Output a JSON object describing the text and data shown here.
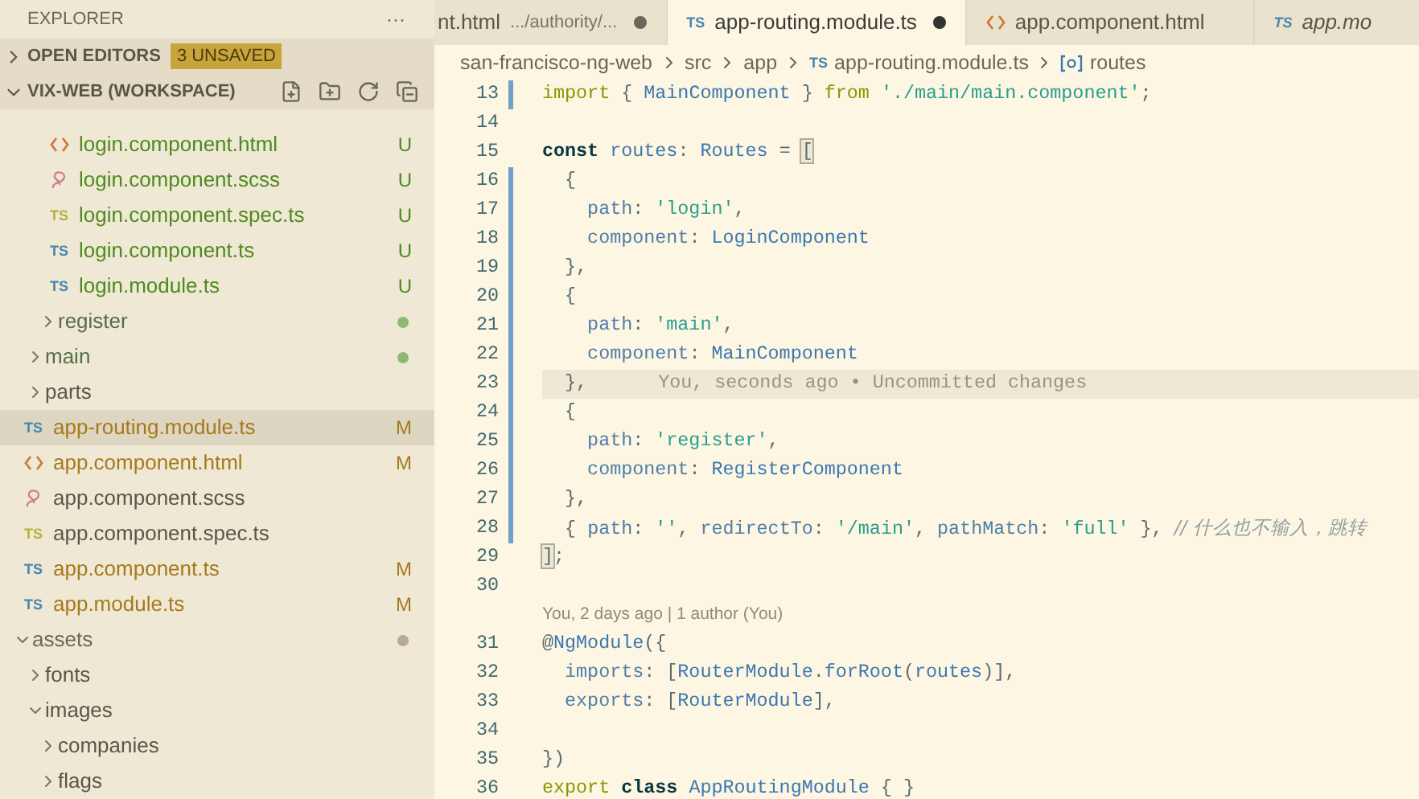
{
  "sidebar": {
    "title": "EXPLORER",
    "more": "···",
    "sections": [
      {
        "label": "OPEN EDITORS",
        "expanded": false,
        "badge": "3 UNSAVED"
      },
      {
        "label": "VIX-WEB (WORKSPACE)",
        "expanded": true
      }
    ],
    "tree": [
      {
        "kind": "folder",
        "children": [
          {
            "kind": "folder",
            "children": [
              {
                "kind": "folder",
                "children": [
                  {
                    "name": "login.component.html",
                    "kind": "html",
                    "status": "U",
                    "selected": false
                  },
                  {
                    "name": "login.component.scss",
                    "kind": "scss",
                    "status": "U",
                    "selected": false
                  },
                  {
                    "name": "login.component.spec.ts",
                    "kind": "spec",
                    "icon_label": "TS",
                    "status": "U",
                    "selected": false
                  },
                  {
                    "name": "login.component.ts",
                    "kind": "ts",
                    "icon_label": "TS",
                    "status": "U",
                    "selected": false
                  },
                  {
                    "name": "login.module.ts",
                    "kind": "ts",
                    "icon_label": "TS",
                    "status": "U",
                    "selected": false
                  }
                ]
              },
              {
                "name": "register",
                "kind": "folder",
                "expanded": false,
                "color": "#8fb873",
                "selected": false
              }
            ]
          },
          {
            "name": "main",
            "kind": "folder",
            "expanded": false,
            "color": "#8fb873",
            "selected": false
          },
          {
            "name": "parts",
            "kind": "folder",
            "expanded": false,
            "selected": false
          },
          {
            "name": "app-routing.module.ts",
            "kind": "ts",
            "icon_label": "TS",
            "status": "M",
            "selected": true
          },
          {
            "name": "app.component.html",
            "kind": "html",
            "status": "M",
            "selected": false
          },
          {
            "name": "app.component.scss",
            "kind": "scss",
            "selected": false
          },
          {
            "name": "app.component.spec.ts",
            "kind": "spec",
            "icon_label": "TS",
            "selected": false
          },
          {
            "name": "app.component.ts",
            "kind": "ts",
            "icon_label": "TS",
            "status": "M",
            "selected": false
          },
          {
            "name": "app.module.ts",
            "kind": "ts",
            "icon_label": "TS",
            "status": "M",
            "selected": false
          }
        ]
      },
      {
        "name": "assets",
        "kind": "folder",
        "expanded": true,
        "color": "#b8aa92",
        "selected": false,
        "children": [
          {
            "name": "fonts",
            "kind": "folder",
            "expanded": false,
            "selected": false
          },
          {
            "name": "images",
            "kind": "folder",
            "expanded": true,
            "selected": false,
            "children": [
              {
                "name": "companies",
                "kind": "folder",
                "expanded": false,
                "selected": false
              },
              {
                "name": "flags",
                "kind": "folder",
                "expanded": false,
                "selected": false
              }
            ]
          }
        ]
      }
    ]
  },
  "tabs": [
    {
      "label": "nt.html",
      "description": ".../authority/...",
      "selected": false,
      "dirty": true,
      "preview": false
    },
    {
      "label": "app-routing.module.ts",
      "kind": "ts",
      "icon_label": "TS",
      "selected": true,
      "dirty": true,
      "preview": false
    },
    {
      "label": "app.component.html",
      "kind": "html",
      "selected": false,
      "dirty": false,
      "preview": false
    },
    {
      "label": "app.mo",
      "kind": "ts",
      "icon_label": "TS",
      "selected": false,
      "dirty": false,
      "preview": true
    }
  ],
  "breadcrumb": [
    {
      "label": "san-francisco-ng-web"
    },
    {
      "label": "src"
    },
    {
      "label": "app"
    },
    {
      "label": "app-routing.module.ts",
      "kind": "ts",
      "icon_label": "TS"
    },
    {
      "label": "routes",
      "kind": "symbol"
    }
  ],
  "code": [
    {
      "number": "13",
      "modified": true,
      "current": false,
      "tokens": [
        {
          "kind": "kw",
          "text": "import "
        },
        {
          "kind": "p",
          "text": "{ "
        },
        {
          "kind": "id",
          "text": "MainComponent"
        },
        {
          "kind": "p",
          "text": " } "
        },
        {
          "kind": "kw",
          "text": "from "
        },
        {
          "kind": "str",
          "text": "'./main/main.component'"
        },
        {
          "kind": "p",
          "text": ";"
        }
      ]
    },
    {
      "number": "14",
      "modified": false,
      "current": false
    },
    {
      "number": "15",
      "modified": false,
      "current": false,
      "tokens": [
        {
          "kind": "bold",
          "text": "const "
        },
        {
          "kind": "id",
          "text": "routes"
        },
        {
          "kind": "p",
          "text": ": "
        },
        {
          "kind": "id",
          "text": "Routes"
        },
        {
          "kind": "p",
          "text": " = "
        },
        {
          "kind": "match",
          "text": "["
        }
      ]
    },
    {
      "number": "16",
      "modified": true,
      "current": false,
      "tokens": [
        {
          "kind": "p",
          "text": "  {"
        }
      ]
    },
    {
      "number": "17",
      "modified": true,
      "current": false,
      "tokens": [
        {
          "kind": "prop",
          "text": "    path"
        },
        {
          "kind": "p",
          "text": ": "
        },
        {
          "kind": "str",
          "text": "'login'"
        },
        {
          "kind": "p",
          "text": ","
        }
      ]
    },
    {
      "number": "18",
      "modified": true,
      "current": false,
      "tokens": [
        {
          "kind": "prop",
          "text": "    component"
        },
        {
          "kind": "p",
          "text": ": "
        },
        {
          "kind": "id",
          "text": "LoginComponent"
        }
      ]
    },
    {
      "number": "19",
      "modified": true,
      "current": false,
      "tokens": [
        {
          "kind": "p",
          "text": "  },"
        }
      ]
    },
    {
      "number": "20",
      "modified": true,
      "current": false,
      "tokens": [
        {
          "kind": "p",
          "text": "  {"
        }
      ]
    },
    {
      "number": "21",
      "modified": true,
      "current": false,
      "tokens": [
        {
          "kind": "prop",
          "text": "    path"
        },
        {
          "kind": "p",
          "text": ": "
        },
        {
          "kind": "str",
          "text": "'main'"
        },
        {
          "kind": "p",
          "text": ","
        }
      ]
    },
    {
      "number": "22",
      "modified": true,
      "current": false,
      "tokens": [
        {
          "kind": "prop",
          "text": "    component"
        },
        {
          "kind": "p",
          "text": ": "
        },
        {
          "kind": "id",
          "text": "MainComponent"
        }
      ]
    },
    {
      "number": "23",
      "modified": true,
      "current": true,
      "blame": "You, seconds ago • Uncommitted changes",
      "tokens": [
        {
          "kind": "p",
          "text": "  },"
        }
      ]
    },
    {
      "number": "24",
      "modified": true,
      "current": false,
      "tokens": [
        {
          "kind": "p",
          "text": "  {"
        }
      ]
    },
    {
      "number": "25",
      "modified": true,
      "current": false,
      "tokens": [
        {
          "kind": "prop",
          "text": "    path"
        },
        {
          "kind": "p",
          "text": ": "
        },
        {
          "kind": "str",
          "text": "'register'"
        },
        {
          "kind": "p",
          "text": ","
        }
      ]
    },
    {
      "number": "26",
      "modified": true,
      "current": false,
      "tokens": [
        {
          "kind": "prop",
          "text": "    component"
        },
        {
          "kind": "p",
          "text": ": "
        },
        {
          "kind": "id",
          "text": "RegisterComponent"
        }
      ]
    },
    {
      "number": "27",
      "modified": true,
      "current": false,
      "tokens": [
        {
          "kind": "p",
          "text": "  },"
        }
      ]
    },
    {
      "number": "28",
      "modified": true,
      "current": false,
      "tokens": [
        {
          "kind": "p",
          "text": "  { "
        },
        {
          "kind": "prop",
          "text": "path"
        },
        {
          "kind": "p",
          "text": ": "
        },
        {
          "kind": "str",
          "text": "''"
        },
        {
          "kind": "p",
          "text": ", "
        },
        {
          "kind": "prop",
          "text": "redirectTo"
        },
        {
          "kind": "p",
          "text": ": "
        },
        {
          "kind": "str",
          "text": "'/main'"
        },
        {
          "kind": "p",
          "text": ", "
        },
        {
          "kind": "prop",
          "text": "pathMatch"
        },
        {
          "kind": "p",
          "text": ": "
        },
        {
          "kind": "str",
          "text": "'full'"
        },
        {
          "kind": "p",
          "text": " }, "
        },
        {
          "kind": "cm",
          "text": "// 什么也不输入，跳转"
        }
      ]
    },
    {
      "number": "29",
      "modified": false,
      "current": false,
      "tokens": [
        {
          "kind": "match",
          "text": "]"
        },
        {
          "kind": "p",
          "text": ";"
        }
      ]
    },
    {
      "number": "30",
      "modified": false,
      "current": false
    },
    {
      "codelens": "You, 2 days ago | 1 author (You)"
    },
    {
      "number": "31",
      "modified": false,
      "current": false,
      "tokens": [
        {
          "kind": "p",
          "text": "@"
        },
        {
          "kind": "id",
          "text": "NgModule"
        },
        {
          "kind": "p",
          "text": "({"
        }
      ]
    },
    {
      "number": "32",
      "modified": false,
      "current": false,
      "tokens": [
        {
          "kind": "prop",
          "text": "  imports"
        },
        {
          "kind": "p",
          "text": ": ["
        },
        {
          "kind": "id",
          "text": "RouterModule"
        },
        {
          "kind": "p",
          "text": "."
        },
        {
          "kind": "id",
          "text": "forRoot"
        },
        {
          "kind": "p",
          "text": "("
        },
        {
          "kind": "id",
          "text": "routes"
        },
        {
          "kind": "p",
          "text": ")],"
        }
      ]
    },
    {
      "number": "33",
      "modified": false,
      "current": false,
      "tokens": [
        {
          "kind": "prop",
          "text": "  exports"
        },
        {
          "kind": "p",
          "text": ": ["
        },
        {
          "kind": "id",
          "text": "RouterModule"
        },
        {
          "kind": "p",
          "text": "],"
        }
      ]
    },
    {
      "number": "34",
      "modified": false,
      "current": false
    },
    {
      "number": "35",
      "modified": false,
      "current": false,
      "tokens": [
        {
          "kind": "p",
          "text": "})"
        }
      ]
    },
    {
      "number": "36",
      "modified": false,
      "current": false,
      "tokens": [
        {
          "kind": "kw",
          "text": "export "
        },
        {
          "kind": "bold",
          "text": "class "
        },
        {
          "kind": "id",
          "text": "AppRoutingModule"
        },
        {
          "kind": "p",
          "text": " { }"
        }
      ]
    }
  ]
}
